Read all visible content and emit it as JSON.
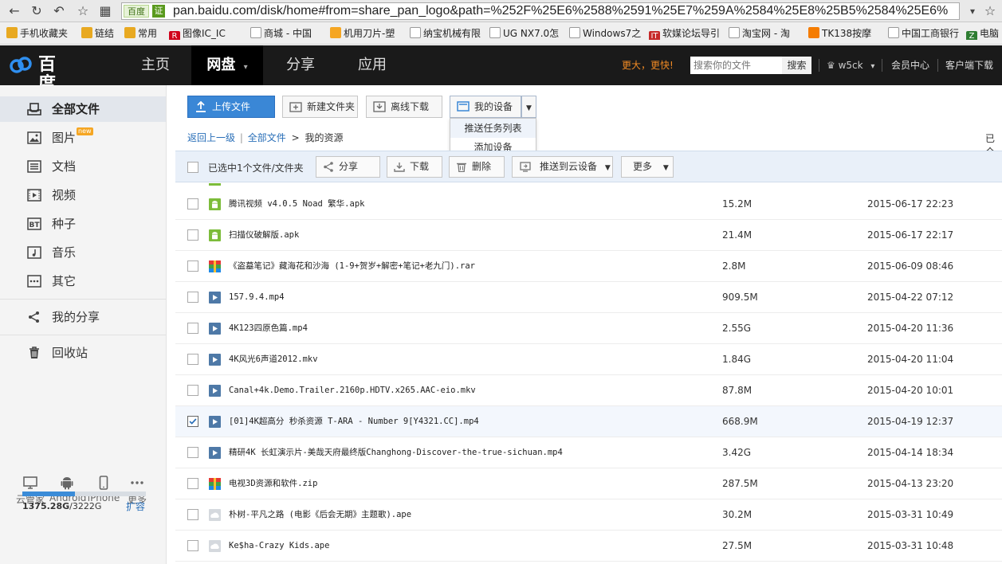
{
  "browser": {
    "url_site_badge": "百度",
    "url_ev_badge": "证",
    "url": "pan.baidu.com/disk/home#from=share_pan_logo&path=%252F%25E6%2588%2591%25E7%259A%2584%25E8%25B5%2584%25E6%",
    "bookmarks": [
      {
        "label": "手机收藏夹",
        "icon": "folder-icon",
        "color": "#e8a921"
      },
      {
        "label": "链结",
        "icon": "folder-icon",
        "color": "#e8a921"
      },
      {
        "label": "常用",
        "icon": "folder-icon",
        "color": "#e8a921"
      },
      {
        "label": "图像IC_IC",
        "icon": "r-logo-icon",
        "color": "#d0021b"
      },
      {
        "label": "商城 - 中国",
        "icon": "page-icon",
        "color": "#999999"
      },
      {
        "label": "机用刀片-塑",
        "icon": "tool-icon",
        "color": "#f5a623"
      },
      {
        "label": "纳宝机械有限",
        "icon": "page-icon",
        "color": "#999999"
      },
      {
        "label": "UG NX7.0怎",
        "icon": "page-icon",
        "color": "#999999"
      },
      {
        "label": "Windows7之",
        "icon": "page-icon",
        "color": "#999999"
      },
      {
        "label": "软媒论坛导引",
        "icon": "it-logo-icon",
        "color": "#c62828"
      },
      {
        "label": "淘宝网 - 淘",
        "icon": "page-icon",
        "color": "#999999"
      },
      {
        "label": "TK138按摩",
        "icon": "tk-logo-icon",
        "color": "#f57c00"
      },
      {
        "label": "中国工商银行",
        "icon": "page-icon",
        "color": "#999999"
      },
      {
        "label": "电脑",
        "icon": "z-logo-icon",
        "color": "#2e7d32"
      }
    ]
  },
  "nav": {
    "logo_text": "百度云",
    "tabs": [
      {
        "label": "主页",
        "active": false
      },
      {
        "label": "网盘",
        "active": true
      },
      {
        "label": "分享",
        "active": false
      },
      {
        "label": "应用",
        "active": false
      }
    ],
    "promo": "更大，更快!",
    "search_placeholder": "搜索你的文件",
    "search_button": "搜索",
    "username": "w5ck",
    "member_center": "会员中心",
    "client_download": "客户端下载"
  },
  "sidebar": {
    "items": [
      {
        "label": "全部文件",
        "icon": "all-files-icon",
        "active": true
      },
      {
        "label": "图片",
        "icon": "image-icon",
        "active": false,
        "badge": "new"
      },
      {
        "label": "文档",
        "icon": "document-icon",
        "active": false
      },
      {
        "label": "视频",
        "icon": "video-icon",
        "active": false
      },
      {
        "label": "种子",
        "icon": "bt-icon",
        "active": false
      },
      {
        "label": "音乐",
        "icon": "music-icon",
        "active": false
      },
      {
        "label": "其它",
        "icon": "other-icon",
        "active": false
      }
    ],
    "share": {
      "label": "我的分享",
      "icon": "share-icon"
    },
    "trash": {
      "label": "回收站",
      "icon": "trash-icon"
    },
    "devices": [
      {
        "label": "云管家",
        "icon": "monitor-icon"
      },
      {
        "label": "Android",
        "icon": "android-icon"
      },
      {
        "label": "iPhone",
        "icon": "phone-icon"
      },
      {
        "label": "更多",
        "icon": "more-dots-icon"
      }
    ],
    "quota": {
      "used": "1375.28G",
      "total": "3222G",
      "fraction": 0.427,
      "expand": "扩容"
    }
  },
  "toolbar": {
    "upload": "上传文件",
    "new_folder": "新建文件夹",
    "offline_download": "离线下载",
    "my_devices": "我的设备",
    "device_menu": [
      "推送任务列表",
      "添加设备"
    ]
  },
  "breadcrumb": {
    "back": "返回上一级",
    "all_files": "全部文件",
    "separator": ">",
    "current": "我的资源",
    "right_text": "已全"
  },
  "actionbar": {
    "selected_text": "已选中1个文件/文件夹",
    "share": "分享",
    "download": "下载",
    "delete": "删除",
    "push": "推送到云设备",
    "more": "更多"
  },
  "files": [
    {
      "name": "腾讯视频 v4.0.5 Noad 繁华.apk",
      "size": "15.2M",
      "date": "2015-06-17 22:23",
      "type": "apk",
      "checked": false
    },
    {
      "name": "扫描仪破解版.apk",
      "size": "21.4M",
      "date": "2015-06-17 22:17",
      "type": "apk",
      "checked": false
    },
    {
      "name": "《盗墓笔记》藏海花和沙海 (1-9+贺岁+解密+笔记+老九门).rar",
      "size": "2.8M",
      "date": "2015-06-09 08:46",
      "type": "archive",
      "checked": false
    },
    {
      "name": "157.9.4.mp4",
      "size": "909.5M",
      "date": "2015-04-22 07:12",
      "type": "video",
      "checked": false
    },
    {
      "name": "4K123四原色篇.mp4",
      "size": "2.55G",
      "date": "2015-04-20 11:36",
      "type": "video",
      "checked": false
    },
    {
      "name": "4K风光6声道2012.mkv",
      "size": "1.84G",
      "date": "2015-04-20 11:04",
      "type": "video",
      "checked": false
    },
    {
      "name": "Canal+4k.Demo.Trailer.2160p.HDTV.x265.AAC-eio.mkv",
      "size": "87.8M",
      "date": "2015-04-20 10:01",
      "type": "video",
      "checked": false
    },
    {
      "name": "[01]4K超高分 秒杀资源 T-ARA - Number 9[Y4321.CC].mp4",
      "size": "668.9M",
      "date": "2015-04-19 12:37",
      "type": "video",
      "checked": true
    },
    {
      "name": "精研4K 长虹演示片-美哉天府最终版Changhong-Discover-the-true-sichuan.mp4",
      "size": "3.42G",
      "date": "2015-04-14 18:34",
      "type": "video",
      "checked": false
    },
    {
      "name": "电视3D资源和软件.zip",
      "size": "287.5M",
      "date": "2015-04-13 23:20",
      "type": "archive",
      "checked": false
    },
    {
      "name": "朴树-平凡之路 (电影《后会无期》主题歌).ape",
      "size": "30.2M",
      "date": "2015-03-31 10:49",
      "type": "audio",
      "checked": false
    },
    {
      "name": "Ke$ha-Crazy Kids.ape",
      "size": "27.5M",
      "date": "2015-03-31 10:48",
      "type": "audio",
      "checked": false
    }
  ],
  "colors": {
    "accent": "#3a87d6",
    "nav_bg": "#1a1a1a",
    "promo": "#f08a24",
    "link": "#2a6fb8"
  }
}
